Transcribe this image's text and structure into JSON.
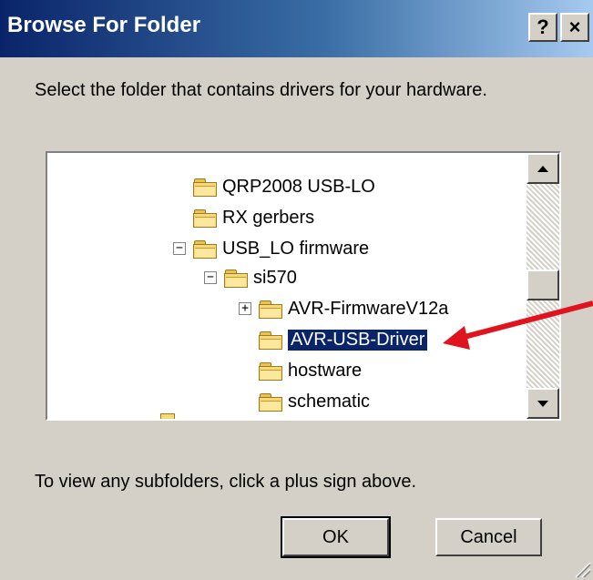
{
  "window": {
    "title": "Browse For Folder",
    "help_label": "?",
    "close_label": "×"
  },
  "prompt": "Select the folder that contains drivers for your hardware.",
  "tree": {
    "items": [
      {
        "label": "QRP2008 USB-LO"
      },
      {
        "label": "RX gerbers"
      },
      {
        "label": "USB_LO firmware",
        "expander": "−"
      },
      {
        "label": "si570",
        "expander": "−"
      },
      {
        "label": "AVR-FirmwareV12a",
        "expander": "+"
      },
      {
        "label": "AVR-USB-Driver",
        "selected": true
      },
      {
        "label": "hostware"
      },
      {
        "label": "schematic"
      }
    ]
  },
  "hint": "To view any subfolders, click a plus sign above.",
  "buttons": {
    "ok": "OK",
    "cancel": "Cancel"
  },
  "colors": {
    "title_start": "#0a246a",
    "title_end": "#a6caf0",
    "selection": "#0a246a",
    "annotation_arrow": "#e0141e",
    "folder": "#f6d97a"
  }
}
